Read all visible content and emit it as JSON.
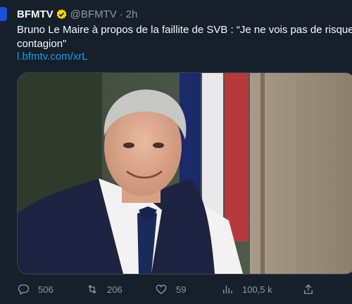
{
  "tweet": {
    "author_name": "BFMTV",
    "handle": "@BFMTV",
    "separator": "·",
    "time": "2h",
    "text_line1": "Bruno Le Maire à propos de la faillite de SVB : “Je ne vois pas de risque de",
    "text_line2": "contagion\"",
    "link": "l.bfmtv.com/xrL"
  },
  "actions": {
    "replies": "506",
    "retweets": "206",
    "likes": "59",
    "views": "100,5 k"
  },
  "icons": {
    "verified": "verified-badge-icon",
    "reply": "reply-icon",
    "retweet": "retweet-icon",
    "like": "heart-icon",
    "views": "views-icon",
    "share": "share-icon"
  },
  "colors": {
    "background": "#15202b",
    "link": "#1d9bf0",
    "verified": "#ffd400",
    "muted": "#8b98a5"
  }
}
